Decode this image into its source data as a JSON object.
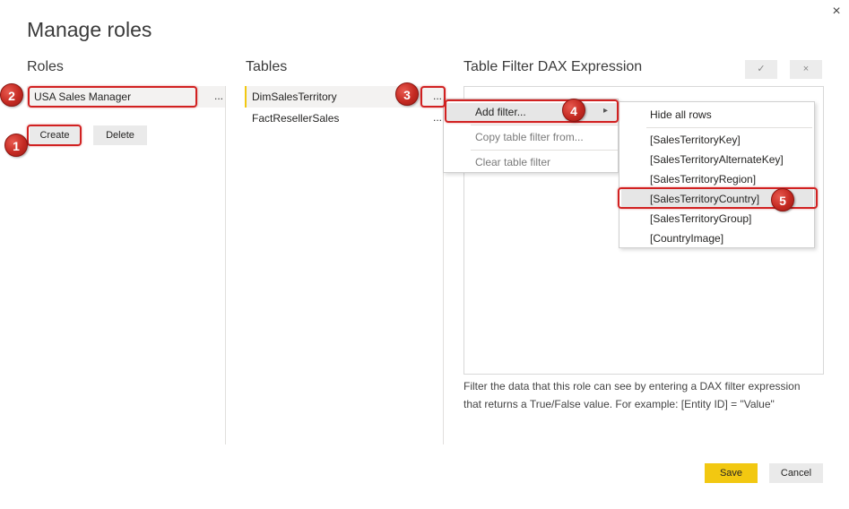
{
  "dialog": {
    "title": "Manage roles",
    "close_glyph": "×"
  },
  "roles": {
    "heading": "Roles",
    "items": [
      {
        "label": "USA Sales Manager",
        "more": "..."
      }
    ],
    "create_label": "Create",
    "delete_label": "Delete"
  },
  "tables": {
    "heading": "Tables",
    "items": [
      {
        "label": "DimSalesTerritory",
        "more": "..."
      },
      {
        "label": "FactResellerSales",
        "more": "..."
      }
    ]
  },
  "filter": {
    "heading": "Table Filter DAX Expression",
    "apply_glyph": "✓",
    "discard_glyph": "×",
    "hint": "Filter the data that this role can see by entering a DAX filter expression that returns a True/False value. For example: [Entity ID] = \"Value\""
  },
  "context_menu": {
    "items": [
      {
        "label": "Add filter...",
        "submenu_glyph": "▸"
      },
      {
        "label": "Copy table filter from..."
      },
      {
        "label": "Clear table filter"
      }
    ]
  },
  "submenu": {
    "items": [
      {
        "label": "Hide all rows"
      },
      {
        "label": "[SalesTerritoryKey]"
      },
      {
        "label": "[SalesTerritoryAlternateKey]"
      },
      {
        "label": "[SalesTerritoryRegion]"
      },
      {
        "label": "[SalesTerritoryCountry]"
      },
      {
        "label": "[SalesTerritoryGroup]"
      },
      {
        "label": "[CountryImage]"
      }
    ]
  },
  "badges": [
    "1",
    "2",
    "3",
    "4",
    "5"
  ],
  "footer": {
    "save_label": "Save",
    "cancel_label": "Cancel"
  },
  "colors": {
    "accent": "#f2c811",
    "annotation_red": "#d12121"
  }
}
